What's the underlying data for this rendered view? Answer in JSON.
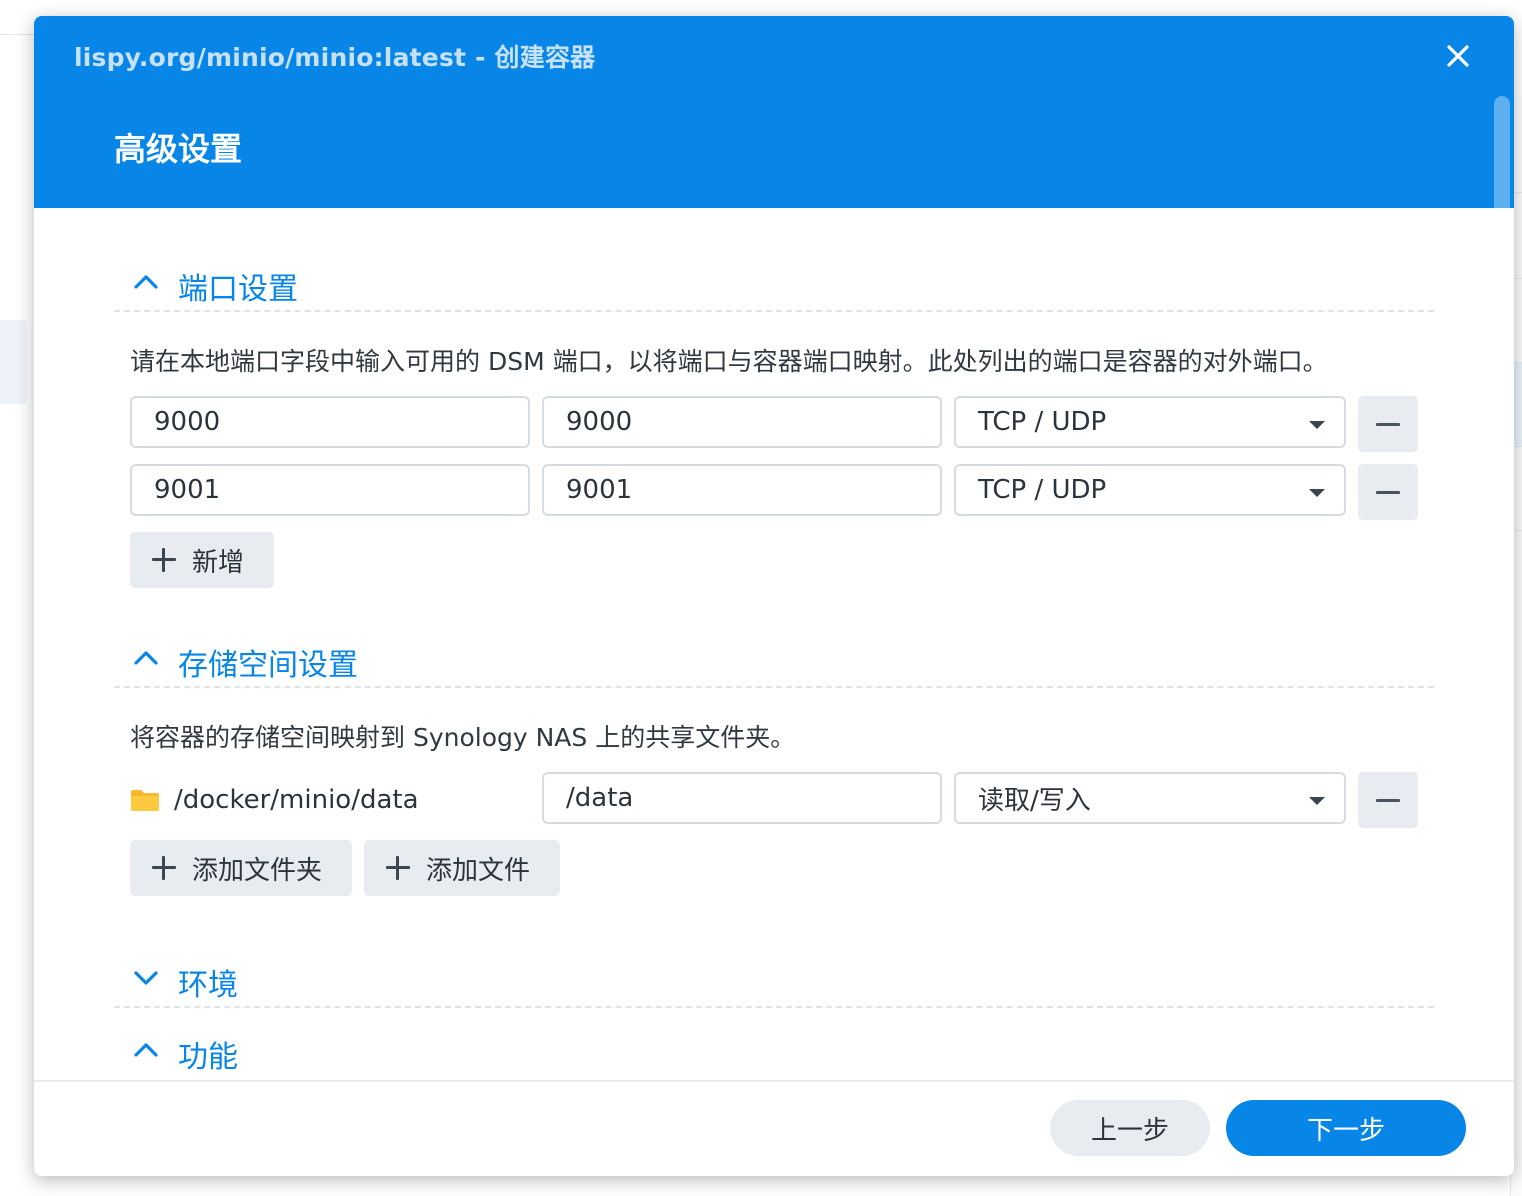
{
  "window": {
    "title": "lispy.org/minio/minio:latest - 创建容器",
    "step_title": "高级设置",
    "accent_color": "#0786e8"
  },
  "port_settings": {
    "title": "端口设置",
    "description": "请在本地端口字段中输入可用的 DSM 端口，以将端口与容器端口映射。此处列出的端口是容器的对外端口。",
    "rows": [
      {
        "local_port": "9000",
        "container_port": "9000",
        "protocol": "TCP / UDP"
      },
      {
        "local_port": "9001",
        "container_port": "9001",
        "protocol": "TCP / UDP"
      }
    ],
    "add_label": "新增"
  },
  "storage_settings": {
    "title": "存储空间设置",
    "description": "将容器的存储空间映射到 Synology NAS 上的共享文件夹。",
    "rows": [
      {
        "host_path": "/docker/minio/data",
        "mount_path": "/data",
        "permission": "读取/写入"
      }
    ],
    "add_folder_label": "添加文件夹",
    "add_file_label": "添加文件"
  },
  "environment": {
    "title": "环境"
  },
  "features": {
    "title": "功能"
  },
  "footer": {
    "prev_label": "上一步",
    "next_label": "下一步"
  },
  "icons": {
    "close": "close-icon",
    "section_expanded": "chevron-up-icon",
    "section_collapsed": "chevron-down-icon",
    "dropdown": "caret-down-icon",
    "remove": "minus-icon",
    "add": "plus-icon",
    "folder": "folder-icon"
  }
}
